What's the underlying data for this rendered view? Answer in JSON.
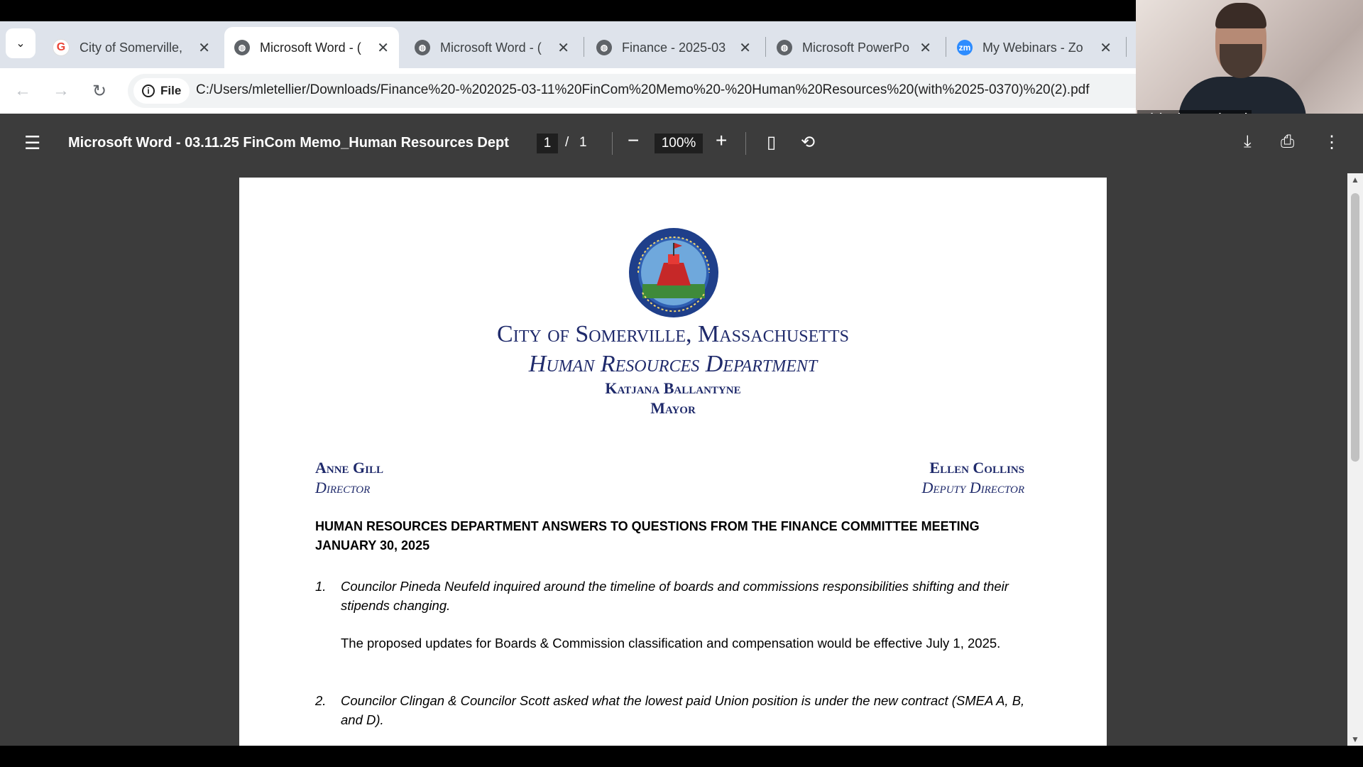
{
  "browser": {
    "tabs": [
      {
        "title": "City of Somerville,",
        "favicon": "google-icon",
        "active": false
      },
      {
        "title": "Microsoft Word - (",
        "favicon": "globe-icon",
        "active": true
      },
      {
        "title": "Microsoft Word - (",
        "favicon": "globe-icon",
        "active": false
      },
      {
        "title": "Finance - 2025-03",
        "favicon": "globe-icon",
        "active": false
      },
      {
        "title": "Microsoft PowerPo",
        "favicon": "globe-icon",
        "active": false
      },
      {
        "title": "My Webinars - Zo",
        "favicon": "zoom-icon",
        "active": false
      }
    ],
    "close_glyph": "✕",
    "site_chip": "File",
    "url": "C:/Users/mletellier/Downloads/Finance%20-%202025-03-11%20FinCom%20Memo%20-%20Human%20Resources%20(with%2025-0370)%20(2).pdf"
  },
  "video": {
    "participant_name": "Michael Mastrobuoni"
  },
  "pdf_toolbar": {
    "title": "Microsoft Word - 03.11.25 FinCom Memo_Human Resources Dept",
    "current_page": "1",
    "separator": "/",
    "total_pages": "1",
    "zoom": "100%"
  },
  "document": {
    "city": "City of Somerville, Massachusetts",
    "department": "Human Resources Department",
    "mayor_name": "Katjana Ballantyne",
    "mayor_title": "Mayor",
    "left_name": "Anne Gill",
    "left_title": "Director",
    "right_name": "Ellen Collins",
    "right_title": "Deputy Director",
    "heading": "HUMAN RESOURCES DEPARTMENT ANSWERS TO QUESTIONS FROM THE FINANCE COMMITTEE MEETING JANUARY 30, 2025",
    "items": [
      {
        "number": "1.",
        "question": "Councilor Pineda Neufeld inquired around the timeline of boards and commissions responsibilities shifting and their stipends changing.",
        "answer": "The proposed updates for Boards & Commission classification and compensation would be effective July 1, 2025."
      },
      {
        "number": "2.",
        "question": "Councilor Clingan & Councilor Scott asked what the lowest paid Union position is under the new contract (SMEA A, B, and D)."
      }
    ]
  },
  "colors": {
    "tabbar_bg": "#dee3eb",
    "pdf_toolbar_bg": "#3c3c3c",
    "doc_heading_blue": "#1f2a6b"
  }
}
